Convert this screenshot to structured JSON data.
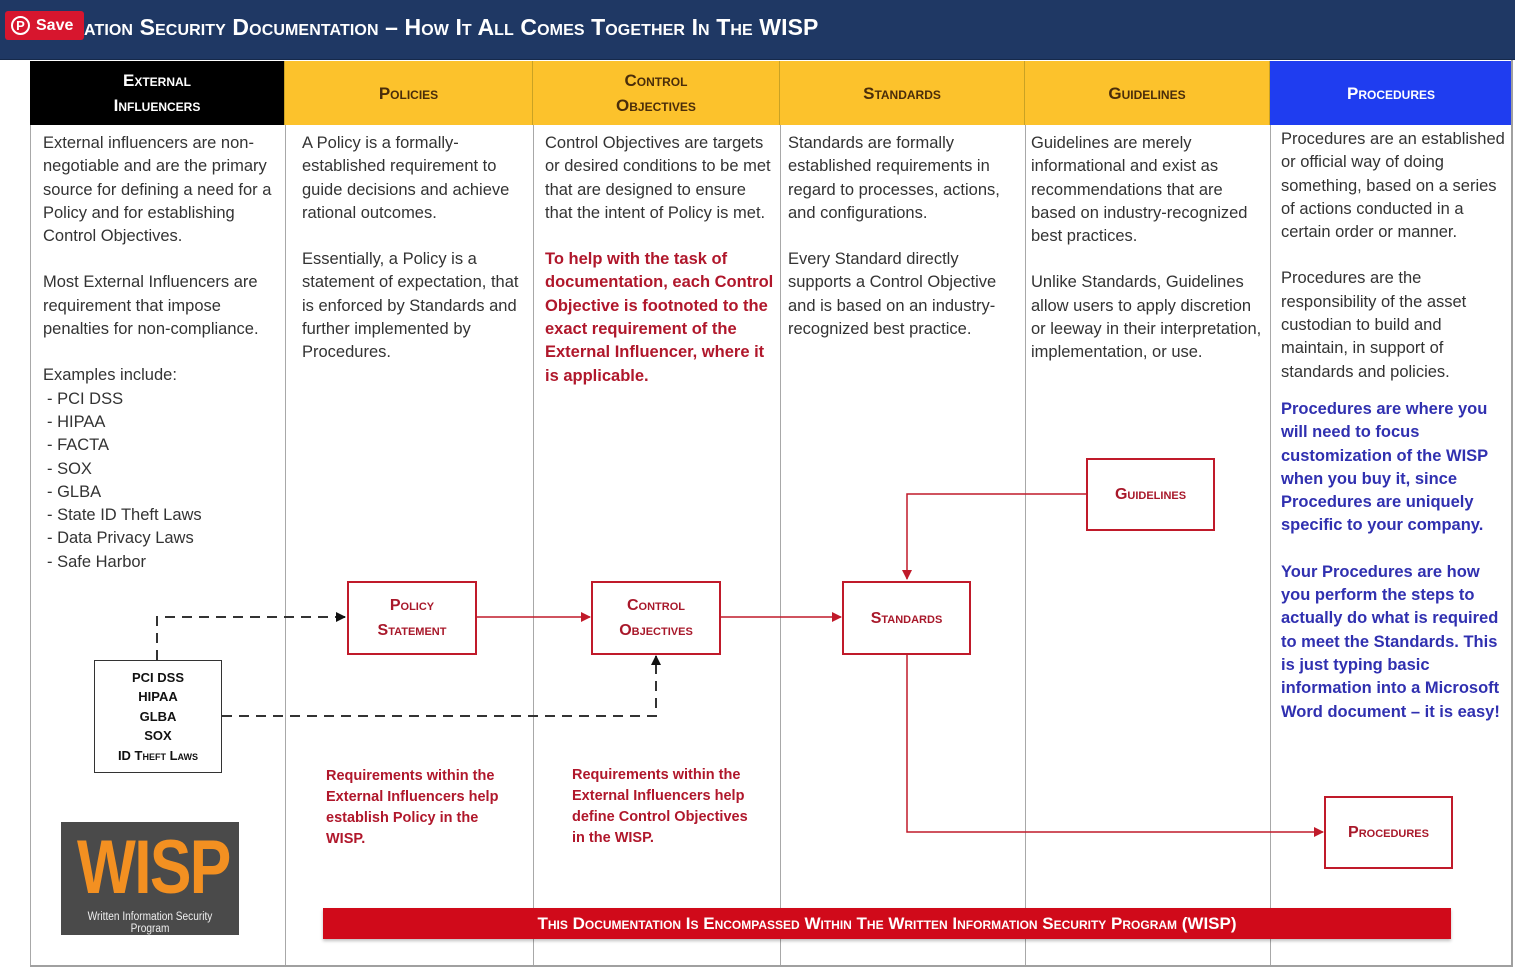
{
  "header": {
    "title": "ation Security Documentation – How It All Comes Together In The WISP",
    "save_button": {
      "label": "Save",
      "icon": "pinterest-icon",
      "color": "#d7162e"
    }
  },
  "colors": {
    "title_bar": "#1f3864",
    "header_black": "#000000",
    "header_yellow": "#fcc22c",
    "header_blue": "#1f3df0",
    "accent_red": "#c01a2a",
    "note_blue": "#3030b0",
    "banner_red": "#d00a1a",
    "logo_orange": "#f39021"
  },
  "columns": [
    {
      "id": "external-influencers",
      "header": [
        "External",
        "Influencers"
      ],
      "paragraphs": [
        "External influencers are non-negotiable and are the primary source for defining a need for a Policy and for establishing Control Objectives.",
        "Most External Influencers are requirement that impose penalties for non-compliance."
      ],
      "examples_label": "Examples include:",
      "examples": [
        "- PCI DSS",
        "- HIPAA",
        "- FACTA",
        "- SOX",
        "- GLBA",
        "- State ID Theft Laws",
        "- Data Privacy Laws",
        "- Safe Harbor"
      ]
    },
    {
      "id": "policies",
      "header": [
        "Policies"
      ],
      "paragraphs": [
        "A Policy is a formally-established requirement to guide decisions and achieve rational outcomes.",
        "Essentially, a Policy is a statement of expectation, that is enforced by Standards and further implemented by Procedures."
      ]
    },
    {
      "id": "control-objectives",
      "header": [
        "Control",
        "Objectives"
      ],
      "paragraphs": [
        "Control Objectives are targets or desired conditions to be met that are designed to ensure that the intent of Policy is met."
      ],
      "highlight": "To help with the task of documentation, each Control Objective is footnoted to the exact requirement of the External Influencer, where it is applicable."
    },
    {
      "id": "standards",
      "header": [
        "Standards"
      ],
      "paragraphs": [
        "Standards are formally established requirements in regard to processes, actions, and configurations.",
        "Every Standard directly supports a Control Objective and is based on an industry-recognized best practice."
      ]
    },
    {
      "id": "guidelines",
      "header": [
        "Guidelines"
      ],
      "paragraphs": [
        "Guidelines are merely informational and exist as recommendations that are based on industry-recognized best practices.",
        "Unlike Standards, Guidelines allow users to apply discretion or leeway in their interpretation, implementation, or use."
      ]
    },
    {
      "id": "procedures",
      "header": [
        "Procedures"
      ],
      "paragraphs": [
        "Procedures are an established or official way of doing something, based on a series of actions conducted in a certain order or manner.",
        "Procedures are the responsibility of the asset custodian to build and maintain, in support of standards and policies."
      ],
      "highlights": [
        "Procedures are where you will need to focus customization of the WISP when you buy it, since Procedures are uniquely specific to your company.",
        "Your Procedures are how you perform the steps to actually do what is required to meet the Standards. This is just typing basic information into a Microsoft Word document – it is easy!"
      ]
    }
  ],
  "flow": {
    "external_box": [
      "PCI DSS",
      "HIPAA",
      "GLBA",
      "SOX",
      "ID Theft Laws"
    ],
    "boxes": {
      "policy_statement": [
        "Policy",
        "Statement"
      ],
      "control_objectives": [
        "Control",
        "Objectives"
      ],
      "standards": [
        "Standards"
      ],
      "guidelines": [
        "Guidelines"
      ],
      "procedures": [
        "Procedures"
      ]
    },
    "edges": [
      {
        "from": "external_box",
        "to": "policy_statement",
        "style": "dashed"
      },
      {
        "from": "external_box",
        "to": "control_objectives",
        "style": "dashed"
      },
      {
        "from": "policy_statement",
        "to": "control_objectives",
        "style": "solid"
      },
      {
        "from": "control_objectives",
        "to": "standards",
        "style": "solid"
      },
      {
        "from": "guidelines",
        "to": "standards",
        "style": "solid"
      },
      {
        "from": "standards",
        "to": "procedures",
        "style": "solid"
      }
    ],
    "notes": {
      "policies": "Requirements within the External Influencers help establish Policy in the WISP.",
      "control_objectives": "Requirements within the External Influencers help define Control Objectives in the WISP."
    }
  },
  "logo": {
    "word": "WISP",
    "subtitle": "Written Information Security Program"
  },
  "footer_banner": "This Documentation Is Encompassed Within The Written Information Security Program (WISP)"
}
